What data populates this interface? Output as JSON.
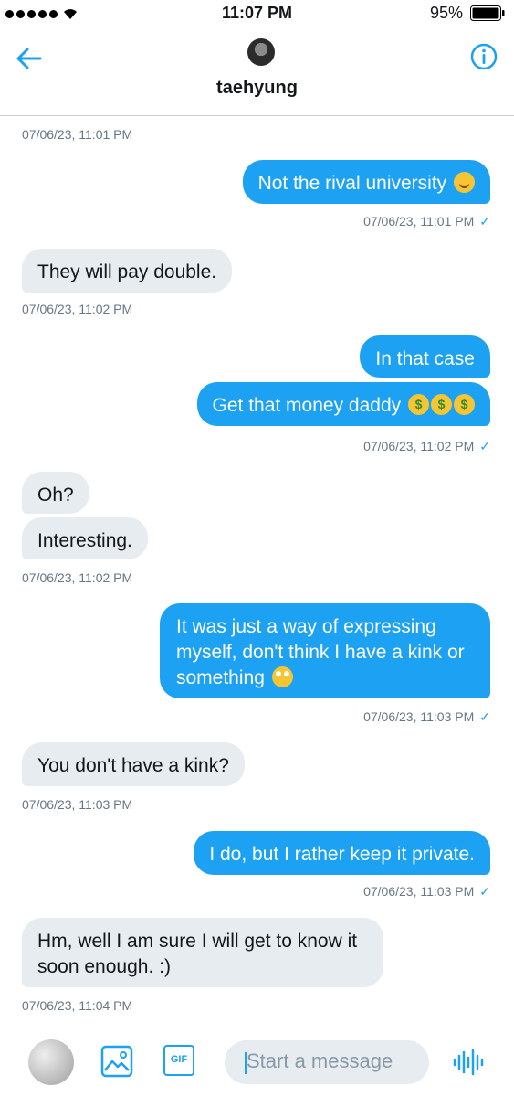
{
  "status_bar": {
    "time": "11:07 PM",
    "battery": "95%",
    "signal_bars": 5
  },
  "header": {
    "name": "taehyung"
  },
  "messages": [
    {
      "id": "ts0",
      "type": "timestamp",
      "text": "07/06/23, 11:01 PM"
    },
    {
      "id": "m1",
      "dir": "out",
      "text": "Not the rival university",
      "emoji": "loudly-crying-face"
    },
    {
      "id": "ts1",
      "type": "timestamp",
      "text": "07/06/23, 11:01 PM",
      "read": "✓"
    },
    {
      "id": "m2",
      "dir": "in",
      "text": "They will pay double."
    },
    {
      "id": "ts2",
      "type": "timestamp",
      "text": "07/06/23, 11:02 PM"
    },
    {
      "id": "m3",
      "dir": "out",
      "text": "In that case"
    },
    {
      "id": "m4",
      "dir": "out",
      "text": "Get that money daddy",
      "emoji": "money-mouth-face x3"
    },
    {
      "id": "ts3",
      "type": "timestamp",
      "text": "07/06/23, 11:02 PM",
      "read": "✓"
    },
    {
      "id": "m5",
      "dir": "in",
      "text": "Oh?"
    },
    {
      "id": "m6",
      "dir": "in",
      "text": "Interesting."
    },
    {
      "id": "ts4",
      "type": "timestamp",
      "text": "07/06/23, 11:02 PM"
    },
    {
      "id": "m7",
      "dir": "out",
      "lines": [
        "It was just a way of expressing",
        "myself, don't think I have a kink or",
        "something"
      ],
      "emoji": "face-with-rolling-eyes"
    },
    {
      "id": "ts5",
      "type": "timestamp",
      "text": "07/06/23, 11:03 PM",
      "read": "✓"
    },
    {
      "id": "m8",
      "dir": "in",
      "text": "You don't have a kink?"
    },
    {
      "id": "ts6",
      "type": "timestamp",
      "text": "07/06/23, 11:03 PM"
    },
    {
      "id": "m9",
      "dir": "out",
      "text": "I do, but I rather keep it private."
    },
    {
      "id": "ts7",
      "type": "timestamp",
      "text": "07/06/23, 11:03 PM",
      "read": "✓"
    },
    {
      "id": "m10",
      "dir": "in",
      "lines": [
        "Hm, well I am sure I will get to know it",
        "soon enough. :)"
      ]
    },
    {
      "id": "ts8",
      "type": "timestamp",
      "text": "07/06/23, 11:04 PM"
    }
  ],
  "composer": {
    "placeholder": "Start a message",
    "icons": [
      "image-icon",
      "gif-icon",
      "voice-icon"
    ],
    "gif_label": "GIF"
  },
  "colors": {
    "accent": "#1da1f2",
    "incoming": "#e6ecf0",
    "timestamp": "#657786"
  }
}
